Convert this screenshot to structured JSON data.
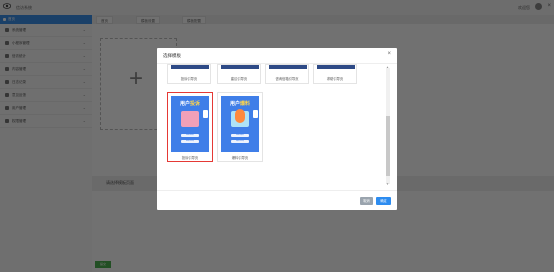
{
  "app": {
    "title": "信访系统",
    "user": "欢迎您",
    "close": "×"
  },
  "sidebar": {
    "home_label": "首页",
    "items": [
      {
        "label": "系统管理"
      },
      {
        "label": "小程序管理"
      },
      {
        "label": "信访统计"
      },
      {
        "label": "内容管理"
      },
      {
        "label": "日志记录"
      },
      {
        "label": "意见反馈"
      },
      {
        "label": "用户管理"
      },
      {
        "label": "权限管理"
      }
    ]
  },
  "tabs": [
    {
      "label": "首页"
    },
    {
      "label": "模板设置"
    },
    {
      "label": "模板配置"
    }
  ],
  "page": {
    "upload_plus": "+",
    "section_label": "请选择模板页面",
    "bottom_button": "提交"
  },
  "modal": {
    "title": "选择模板",
    "close": "×",
    "top_row": [
      {
        "label": "投诉引导页"
      },
      {
        "label": "建议引导页"
      },
      {
        "label": "咨询信箱引导页"
      },
      {
        "label": "求助引导页"
      }
    ],
    "templates": [
      {
        "title_a": "用户",
        "title_b": "投诉",
        "button1": "我要投诉",
        "button2": "投诉查询",
        "label": "投诉引导页",
        "selected": true
      },
      {
        "title_a": "用户",
        "title_b": "爆料",
        "button1": "我要爆料",
        "button2": "爆料查询",
        "label": "爆料引导页",
        "selected": false
      }
    ],
    "scroll_up": "▲",
    "scroll_down": "▼",
    "cancel_label": "取消",
    "ok_label": "确定"
  },
  "colors": {
    "primary": "#2d8cf0",
    "selected_border": "#e53935",
    "template_bg": "#3f7ee8",
    "highlight": "#ffd54a"
  }
}
